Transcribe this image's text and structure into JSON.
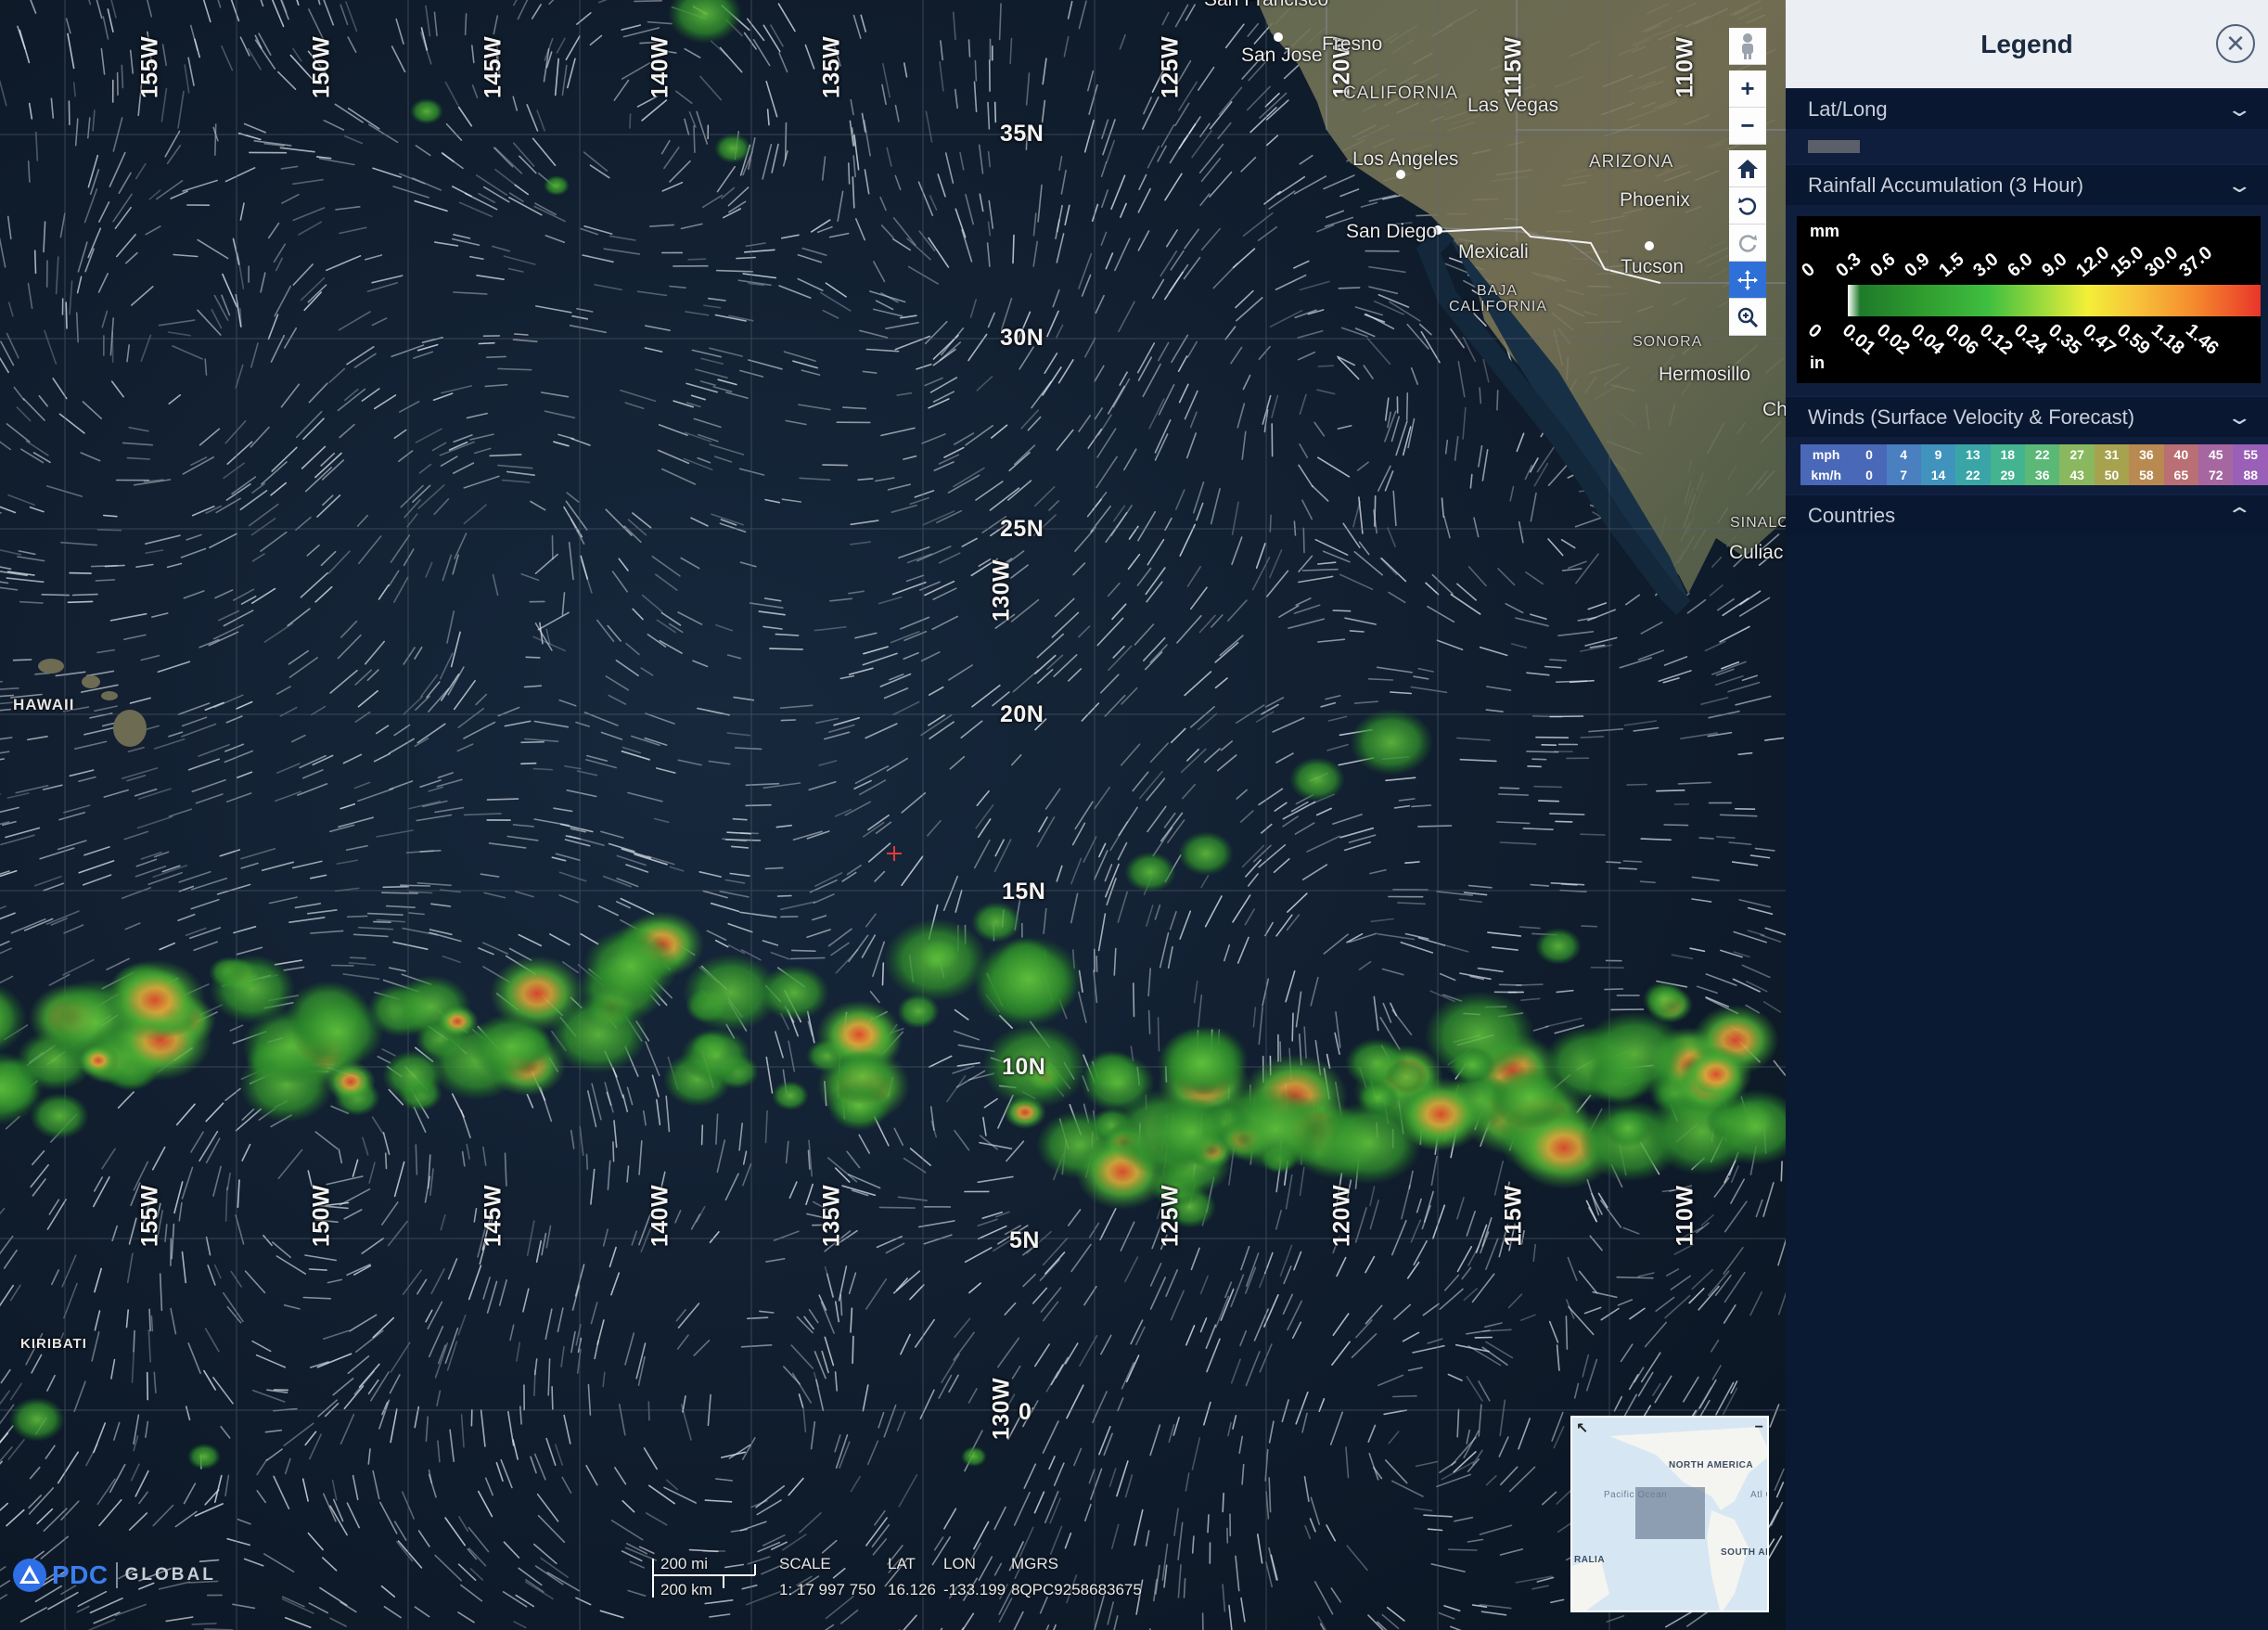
{
  "map": {
    "lat_lines": [
      {
        "label": "35N"
      },
      {
        "label": "30N"
      },
      {
        "label": "25N"
      },
      {
        "label": "20N"
      },
      {
        "label": "15N"
      },
      {
        "label": "10N"
      },
      {
        "label": "5N"
      },
      {
        "label": "0"
      }
    ],
    "lon_labels": [
      "155W",
      "150W",
      "145W",
      "140W",
      "135W",
      "125W",
      "120W",
      "115W",
      "110W"
    ],
    "lon_center_label": "130W",
    "places": {
      "san_francisco": "San Francisco",
      "fresno": "Fresno",
      "san_jose": "San Jose",
      "california": "CALIFORNIA",
      "las_vegas": "Las Vegas",
      "los_angeles": "Los Angeles",
      "arizona": "ARIZONA",
      "phoenix": "Phoenix",
      "san_diego": "San Diego",
      "mexicali": "Mexicali",
      "tucson": "Tucson",
      "baja": "BAJA",
      "baja2": "CALIFORNIA",
      "sonora": "SONORA",
      "hermosillo": "Hermosillo",
      "sinaloa": "SINALOA",
      "culiacan": "Culiac",
      "ch": "Ch",
      "hawaii": "HAWAII",
      "kiribati": "KIRIBATI"
    },
    "minimap": {
      "north_america": "NORTH AMERICA",
      "pacific": "Pacific Ocean",
      "south_america": "SOUTH AM",
      "australia": "RALIA",
      "atlantic": "Atl Oc"
    },
    "scale": {
      "mi": "200 mi",
      "km": "200 km",
      "scale_label": "SCALE",
      "scale_value": "1: 17 997 750",
      "lat_label": "LAT",
      "lat_value": "16.126",
      "lon_label": "LON",
      "lon_value": "-133.199",
      "mgrs_label": "MGRS",
      "mgrs_value": "8QPC9258683675"
    },
    "logo": {
      "pdc": "PDC",
      "global": "GLOBAL"
    },
    "toolbar": [
      "person-icon",
      "zoom-in-icon",
      "zoom-out-icon",
      "home-icon",
      "rotate-left-icon",
      "rotate-right-icon",
      "pan-icon",
      "zoom-box-icon"
    ]
  },
  "legend": {
    "title": "Legend",
    "sections": {
      "latlong": "Lat/Long",
      "rain": "Rainfall Accumulation (3 Hour)",
      "winds": "Winds (Surface Velocity & Forecast)",
      "countries": "Countries"
    },
    "rain": {
      "unit_mm": "mm",
      "unit_in": "in",
      "mm_ticks": [
        "0",
        "0.3",
        "0.6",
        "0.9",
        "1.5",
        "3.0",
        "6.0",
        "9.0",
        "12.0",
        "15.0",
        "30.0",
        "37.0"
      ],
      "in_ticks": [
        "0",
        "0.01",
        "0.02",
        "0.04",
        "0.06",
        "0.12",
        "0.24",
        "0.35",
        "0.47",
        "0.59",
        "1.18",
        "1.46"
      ]
    },
    "winds": {
      "mph_label": "mph",
      "kmh_label": "km/h",
      "mph": [
        "0",
        "4",
        "9",
        "13",
        "18",
        "22",
        "27",
        "31",
        "36",
        "40",
        "45",
        "55"
      ],
      "kmh": [
        "0",
        "7",
        "14",
        "22",
        "29",
        "36",
        "43",
        "50",
        "58",
        "65",
        "72",
        "88"
      ],
      "colors": [
        "#4a68b8",
        "#4a7fc0",
        "#3f93bd",
        "#3aa5a6",
        "#44b38f",
        "#5bb876",
        "#8ab85e",
        "#a6a24e",
        "#b88a52",
        "#b96f73",
        "#a667a0",
        "#9a5fb6"
      ]
    }
  }
}
